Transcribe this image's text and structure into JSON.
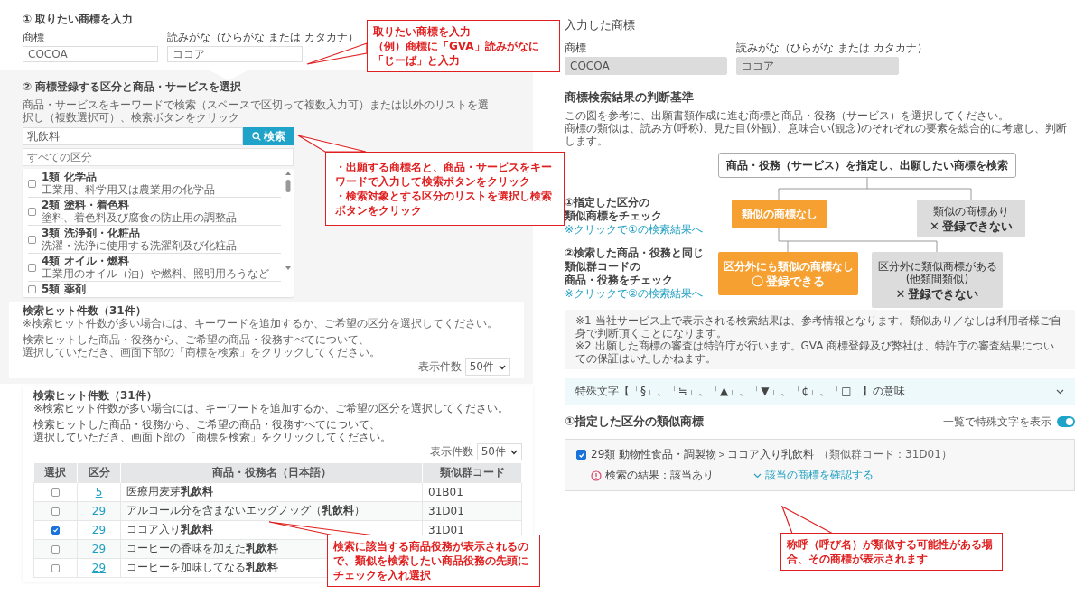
{
  "entry": {
    "title": "① 取りたい商標を入力",
    "fields": [
      {
        "label": "商標",
        "value": "COCOA"
      },
      {
        "label": "読みがな（ひらがな または カタカナ）",
        "value": "ココア"
      }
    ]
  },
  "selection": {
    "title": "② 商標登録する区分と商品・サービスを選択",
    "description": "商品・サービスをキーワードで検索（スペースで区切って複数入力可）または以外のリストを選択し（複数選択可）、検索ボタンをクリック",
    "keyword": "乳飲料",
    "search_button": "検索",
    "class_placeholder": "すべての区分",
    "classes": [
      {
        "title": "1類 化学品",
        "detail": "工業用、科学用又は農業用の化学品",
        "checked": false
      },
      {
        "title": "2類 塗料・着色料",
        "detail": "塗料、着色料及び腐食の防止用の調整品",
        "checked": false
      },
      {
        "title": "3類 洗浄剤・化粧品",
        "detail": "洗濯・洗浄に使用する洗濯剤及び化粧品",
        "checked": false
      },
      {
        "title": "4類 オイル・燃料",
        "detail": "工業用のオイル（油）や燃料、照明用ろうなど",
        "checked": false
      },
      {
        "title": "5類 薬剤",
        "checked": false
      }
    ]
  },
  "hits_preview": {
    "title": "検索ヒット件数（31件）",
    "notes": [
      "※検索ヒット件数が多い場合には、キーワードを追加するか、ご希望の区分を選択してください。",
      "検索ヒットした商品・役務から、ご希望の商品・役務すべてについて、",
      "選択していただき、画面下部の「商標を検索」をクリックしてください。"
    ],
    "per_page_label": "表示件数",
    "per_page": "50件"
  },
  "hits": {
    "title": "検索ヒット件数（31件）",
    "notes": [
      "※検索ヒット件数が多い場合には、キーワードを追加するか、ご希望の区分を選択してください。",
      "検索ヒットした商品・役務から、ご希望の商品・役務すべてについて、",
      "選択していただき、画面下部の「商標を検索」をクリックしてください。"
    ],
    "per_page_label": "表示件数",
    "per_page": "50件",
    "columns": [
      "選択",
      "区分",
      "商品・役務名（日本語）",
      "類似群コード"
    ],
    "rows": [
      {
        "selected": false,
        "class": "5",
        "name": "医療用麦芽**乳飲料**",
        "code": "01B01"
      },
      {
        "selected": false,
        "class": "29",
        "name": "アルコール分を含まないエッグノッグ（**乳飲料**）",
        "code": "31D01"
      },
      {
        "selected": true,
        "class": "29",
        "name": "ココア入り**乳飲料**",
        "code": "31D01"
      },
      {
        "selected": false,
        "class": "29",
        "name": "コーヒーの香味を加えた**乳飲料**"
      },
      {
        "selected": false,
        "class": "29",
        "name": "コーヒーを加味してなる**乳飲料**"
      }
    ]
  },
  "entered": {
    "title": "入力した商標",
    "fields": [
      {
        "label": "商標",
        "value": "COCOA"
      },
      {
        "label": "読みがな（ひらがな または カタカナ）",
        "value": "ココア"
      }
    ]
  },
  "criteria": {
    "title": "商標検索結果の判断基準",
    "description": [
      "この図を参考に、出願書類作成に進む商標と商品・役務（サービス）を選択してください。",
      "商標の類似は、読み方(呼称)、見た目(外観)、意味合い(観念)のそれぞれの要素を総合的に考慮し、判断します。"
    ],
    "flow": {
      "start": "商品・役務（サービス）を指定し、出願したい商標を検索",
      "steps": [
        {
          "lines": [
            "①指定した区分の",
            "類似商標をチェック"
          ],
          "link": "※クリックで①の検索結果へ"
        },
        {
          "lines": [
            "②検索した商品・役務と同じ",
            "類似群コードの",
            "商品・役務をチェック"
          ],
          "link": "※クリックで②の検索結果へ"
        }
      ],
      "nodes": [
        {
          "kind": "ok",
          "lines": [
            "類似の商標なし"
          ]
        },
        {
          "kind": "ng",
          "lines": [
            "類似の商標あり"
          ],
          "verdict": "登録できない",
          "mark": "✕"
        },
        {
          "kind": "ok",
          "lines": [
            "区分外にも類似の商標なし"
          ],
          "verdict": "登録できる",
          "mark": "〇"
        },
        {
          "kind": "ng",
          "lines": [
            "区分外に類似商標がある",
            "(他類間類似)"
          ],
          "verdict": "登録できない",
          "mark": "✕"
        }
      ]
    },
    "notes": [
      "※1 当社サービス上で表示される検索結果は、参考情報となります。類似あり／なしは利用者様ご自身で判断頂くことになります。",
      "※2 出願した商標の審査は特許庁が行います。GVA 商標登録及び弊社は、特許庁の審査結果についての保証はいたしかねます。"
    ]
  },
  "accordion": {
    "label": "特殊文字【「§」、「≒」、「▲」、「▼」、「¢」、「□」】の意味",
    "expanded": false
  },
  "similar": {
    "title": "①指定した区分の類似商標",
    "toggle": {
      "label": "一覧で特殊文字を表示",
      "on": true
    },
    "results": [
      {
        "checked": true,
        "title": "29類 動物性食品・調製物＞ココア入り乳飲料",
        "code": "（類似群コード：31D01）",
        "status": "検索の結果：該当あり",
        "link": "該当の商標を確認する"
      }
    ]
  },
  "callouts": [
    {
      "lines": [
        "取りたい商標を入力",
        "（例）商標に「GVA」読みがなに",
        "「じーば」と入力"
      ]
    },
    {
      "lines": [
        "・出願する商標名と、商品・サービスをキーワードで入力して検索ボタンをクリック",
        "・検索対象とする区分のリストを選択し検索ボタンをクリック"
      ]
    },
    {
      "lines": [
        "検索に該当する商品役務が表示されるので、類似を検索したい商品役務の先頭にチェックを入れ選択"
      ]
    },
    {
      "lines": [
        "称呼（呼び名）が類似する可能性がある場合、その商標が表示されます"
      ]
    }
  ]
}
